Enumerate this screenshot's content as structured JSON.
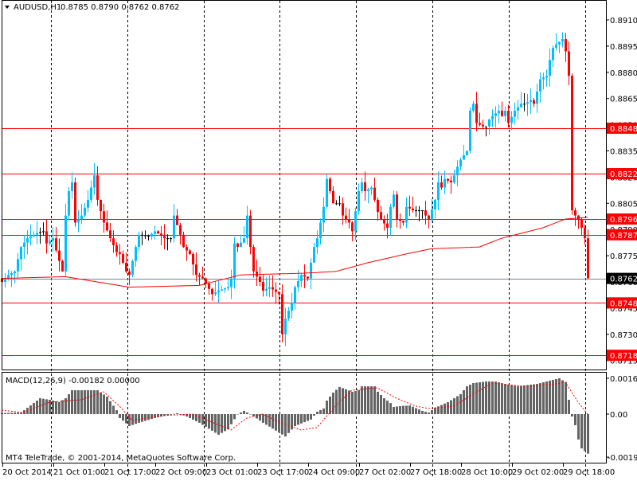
{
  "header": {
    "symbol_label": "AUDUSD,H1",
    "ohlc": "0.8785 0.8790 0.8762 0.8762"
  },
  "macd_header": "MACD(12,26,9) -0.00182 0.00000",
  "copyright": "MT4 TeleTrade, © 2001-2014, MetaQuotes Software Corp.",
  "colors": {
    "bull": "#00BFFF",
    "bear": "#FF0000",
    "doji": "#000000",
    "level": "#FF0000",
    "bid": "#778899",
    "hist": "#646464",
    "signal": "#FF0000",
    "ma": "#FF0000"
  },
  "chart_data": {
    "type": "candlestick",
    "bars": 185,
    "price_axis": {
      "min": 0.8715,
      "max": 0.891,
      "ticks": [
        "0.8910",
        "0.8895",
        "0.8880",
        "0.8865",
        "0.8850",
        "0.8835",
        "0.8820",
        "0.8805",
        "0.8790",
        "0.8775",
        "0.8760",
        "0.8745",
        "0.8730",
        "0.8715"
      ]
    },
    "time_labels": [
      "20 Oct 2014",
      "21 Oct 01:00",
      "21 Oct 17:00",
      "22 Oct 09:00",
      "23 Oct 01:00",
      "23 Oct 17:00",
      "24 Oct 09:00",
      "27 Oct 02:00",
      "27 Oct 18:00",
      "28 Oct 10:00",
      "29 Oct 02:00",
      "29 Oct 18:00"
    ],
    "close_waypoints": [
      [
        0,
        0.876
      ],
      [
        2,
        0.8764
      ],
      [
        4,
        0.8766
      ],
      [
        6,
        0.878
      ],
      [
        8,
        0.8785
      ],
      [
        11,
        0.8788
      ],
      [
        13,
        0.8789
      ],
      [
        14,
        0.8782
      ],
      [
        16,
        0.8785
      ],
      [
        17,
        0.8778
      ],
      [
        19,
        0.8766
      ],
      [
        20,
        0.8798
      ],
      [
        21,
        0.8812
      ],
      [
        22,
        0.8817
      ],
      [
        23,
        0.8794
      ],
      [
        25,
        0.8798
      ],
      [
        27,
        0.8807
      ],
      [
        29,
        0.8821
      ],
      [
        30,
        0.8807
      ],
      [
        32,
        0.8794
      ],
      [
        34,
        0.8785
      ],
      [
        36,
        0.8777
      ],
      [
        37,
        0.8776
      ],
      [
        39,
        0.8766
      ],
      [
        40,
        0.8764
      ],
      [
        42,
        0.878
      ],
      [
        43,
        0.8787
      ],
      [
        46,
        0.8786
      ],
      [
        48,
        0.8789
      ],
      [
        51,
        0.8785
      ],
      [
        53,
        0.8785
      ],
      [
        54,
        0.8798
      ],
      [
        56,
        0.8787
      ],
      [
        57,
        0.878
      ],
      [
        59,
        0.8776
      ],
      [
        61,
        0.8764
      ],
      [
        63,
        0.8762
      ],
      [
        66,
        0.8753
      ],
      [
        68,
        0.8755
      ],
      [
        71,
        0.8757
      ],
      [
        72,
        0.8762
      ],
      [
        73,
        0.8782
      ],
      [
        74,
        0.878
      ],
      [
        76,
        0.8785
      ],
      [
        77,
        0.8798
      ],
      [
        78,
        0.878
      ],
      [
        79,
        0.8766
      ],
      [
        81,
        0.876
      ],
      [
        82,
        0.8755
      ],
      [
        84,
        0.8757
      ],
      [
        87,
        0.8753
      ],
      [
        88,
        0.873
      ],
      [
        89,
        0.8739
      ],
      [
        91,
        0.8748
      ],
      [
        92,
        0.8757
      ],
      [
        94,
        0.8764
      ],
      [
        96,
        0.8762
      ],
      [
        97,
        0.8771
      ],
      [
        98,
        0.878
      ],
      [
        99,
        0.8785
      ],
      [
        101,
        0.8803
      ],
      [
        102,
        0.8819
      ],
      [
        103,
        0.8812
      ],
      [
        104,
        0.8805
      ],
      [
        106,
        0.8805
      ],
      [
        107,
        0.8798
      ],
      [
        109,
        0.8794
      ],
      [
        110,
        0.8789
      ],
      [
        112,
        0.8812
      ],
      [
        113,
        0.8817
      ],
      [
        114,
        0.8812
      ],
      [
        116,
        0.8814
      ],
      [
        117,
        0.8807
      ],
      [
        118,
        0.88
      ],
      [
        119,
        0.8796
      ],
      [
        121,
        0.8791
      ],
      [
        122,
        0.8803
      ],
      [
        123,
        0.881
      ],
      [
        124,
        0.8796
      ],
      [
        126,
        0.8794
      ],
      [
        127,
        0.8803
      ],
      [
        129,
        0.8801
      ],
      [
        132,
        0.8801
      ],
      [
        133,
        0.8798
      ],
      [
        134,
        0.8796
      ],
      [
        136,
        0.8807
      ],
      [
        137,
        0.8817
      ],
      [
        138,
        0.8814
      ],
      [
        139,
        0.8819
      ],
      [
        141,
        0.8817
      ],
      [
        142,
        0.8821
      ],
      [
        143,
        0.8826
      ],
      [
        144,
        0.883
      ],
      [
        146,
        0.8835
      ],
      [
        147,
        0.8858
      ],
      [
        148,
        0.8862
      ],
      [
        149,
        0.8851
      ],
      [
        151,
        0.8849
      ],
      [
        152,
        0.8849
      ],
      [
        153,
        0.8853
      ],
      [
        154,
        0.8855
      ],
      [
        156,
        0.8858
      ],
      [
        157,
        0.8855
      ],
      [
        158,
        0.8858
      ],
      [
        159,
        0.8851
      ],
      [
        161,
        0.8858
      ],
      [
        162,
        0.886
      ],
      [
        163,
        0.8862
      ],
      [
        164,
        0.8862
      ],
      [
        166,
        0.8864
      ],
      [
        167,
        0.8862
      ],
      [
        168,
        0.8869
      ],
      [
        169,
        0.8876
      ],
      [
        171,
        0.8878
      ],
      [
        172,
        0.8887
      ],
      [
        173,
        0.8894
      ],
      [
        174,
        0.8896
      ],
      [
        176,
        0.8899
      ],
      [
        177,
        0.8892
      ],
      [
        178,
        0.8878
      ],
      [
        179,
        0.8801
      ],
      [
        180,
        0.8798
      ],
      [
        181,
        0.8796
      ],
      [
        182,
        0.8791
      ],
      [
        183,
        0.8785
      ],
      [
        184,
        0.8762
      ]
    ],
    "moving_average_waypoints": [
      [
        0,
        0.8762
      ],
      [
        20,
        0.8763
      ],
      [
        40,
        0.8757
      ],
      [
        62,
        0.8758
      ],
      [
        75,
        0.8764
      ],
      [
        95,
        0.8765
      ],
      [
        105,
        0.8766
      ],
      [
        115,
        0.8771
      ],
      [
        127,
        0.8776
      ],
      [
        135,
        0.8779
      ],
      [
        150,
        0.878
      ],
      [
        157,
        0.8785
      ],
      [
        170,
        0.8791
      ],
      [
        177,
        0.8796
      ],
      [
        184,
        0.8797
      ]
    ],
    "levels": [
      {
        "price": "0.8848",
        "color": "#FF0000"
      },
      {
        "price": "0.8822",
        "color": "#FF0000"
      },
      {
        "price": "0.8796",
        "color": "#FF0000"
      },
      {
        "price": "0.8787",
        "color": "#FF0000"
      },
      {
        "price": "0.8762",
        "color": "#778899",
        "bid": true
      },
      {
        "price": "0.8748",
        "color": "#FF0000"
      },
      {
        "price": "0.8718",
        "color": "#FF0000"
      }
    ],
    "macd": {
      "axis_ticks": [
        "0.00165",
        "0.00",
        "-0.00198"
      ],
      "range": [
        -0.00198,
        0.00165
      ],
      "histogram_waypoints": [
        [
          0,
          5e-05
        ],
        [
          6,
          7e-05
        ],
        [
          12,
          0.00073
        ],
        [
          15,
          0.00066
        ],
        [
          18,
          0.00055
        ],
        [
          20,
          0.00073
        ],
        [
          22,
          0.0011
        ],
        [
          30,
          0.0011
        ],
        [
          33,
          0.0008
        ],
        [
          36,
          0.00018
        ],
        [
          37,
          -0.00018
        ],
        [
          40,
          -0.00055
        ],
        [
          43,
          -0.0004
        ],
        [
          48,
          -0.00018
        ],
        [
          55,
          4e-05
        ],
        [
          58,
          -0.00011
        ],
        [
          62,
          -0.0004
        ],
        [
          68,
          -0.00095
        ],
        [
          71,
          -0.0007
        ],
        [
          74,
          0.0
        ],
        [
          76,
          0.00015
        ],
        [
          78,
          0.0
        ],
        [
          82,
          -0.0004
        ],
        [
          89,
          -0.00103
        ],
        [
          92,
          -0.00055
        ],
        [
          97,
          -0.00025
        ],
        [
          99,
          0.00011
        ],
        [
          101,
          0.00026
        ],
        [
          102,
          0.00062
        ],
        [
          104,
          0.00099
        ],
        [
          106,
          0.00125
        ],
        [
          108,
          0.00114
        ],
        [
          110,
          0.00103
        ],
        [
          112,
          0.0011
        ],
        [
          113,
          0.00128
        ],
        [
          117,
          0.00128
        ],
        [
          118,
          0.00103
        ],
        [
          120,
          0.00073
        ],
        [
          122,
          0.00051
        ],
        [
          123,
          0.00033
        ],
        [
          125,
          0.00037
        ],
        [
          128,
          0.0004
        ],
        [
          132,
          0.00015
        ],
        [
          134,
          7e-05
        ],
        [
          136,
          0.00029
        ],
        [
          140,
          0.00055
        ],
        [
          142,
          0.00073
        ],
        [
          144,
          0.00092
        ],
        [
          146,
          0.00128
        ],
        [
          148,
          0.00143
        ],
        [
          152,
          0.0015
        ],
        [
          155,
          0.0015
        ],
        [
          158,
          0.00139
        ],
        [
          162,
          0.00128
        ],
        [
          168,
          0.00139
        ],
        [
          172,
          0.00154
        ],
        [
          175,
          0.00165
        ],
        [
          177,
          0.00147
        ],
        [
          178,
          0.00066
        ],
        [
          179,
          -0.00011
        ],
        [
          180,
          -0.00051
        ],
        [
          181,
          -0.00117
        ],
        [
          182,
          -0.00158
        ],
        [
          183,
          -0.0017
        ],
        [
          184,
          -0.00182
        ]
      ],
      "signal_waypoints": [
        [
          0,
          0.00018
        ],
        [
          7,
          7e-05
        ],
        [
          15,
          0.00055
        ],
        [
          25,
          0.00066
        ],
        [
          32,
          0.00103
        ],
        [
          37,
          0.00037
        ],
        [
          41,
          -0.00029
        ],
        [
          50,
          -7e-05
        ],
        [
          60,
          0.0
        ],
        [
          66,
          -0.00037
        ],
        [
          72,
          -0.00073
        ],
        [
          77,
          -0.00018
        ],
        [
          82,
          0.0
        ],
        [
          87,
          -0.00037
        ],
        [
          94,
          -0.00073
        ],
        [
          99,
          -0.00062
        ],
        [
          102,
          -0.00011
        ],
        [
          106,
          0.00055
        ],
        [
          110,
          0.0011
        ],
        [
          118,
          0.00121
        ],
        [
          124,
          0.00073
        ],
        [
          130,
          0.00037
        ],
        [
          134,
          0.00026
        ],
        [
          142,
          0.00037
        ],
        [
          148,
          0.00092
        ],
        [
          154,
          0.00143
        ],
        [
          164,
          0.00128
        ],
        [
          174,
          0.00139
        ],
        [
          177,
          0.00147
        ],
        [
          181,
          0.00055
        ],
        [
          184,
          0.0
        ]
      ]
    }
  }
}
